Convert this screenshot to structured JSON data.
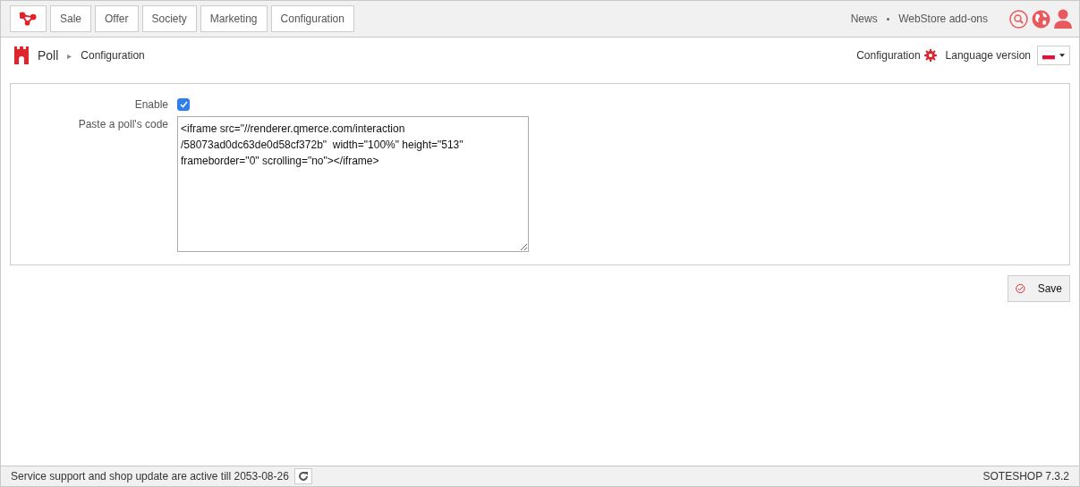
{
  "top_menu": [
    {
      "label": "Sale"
    },
    {
      "label": "Offer"
    },
    {
      "label": "Society"
    },
    {
      "label": "Marketing"
    },
    {
      "label": "Configuration"
    }
  ],
  "top_links": [
    "News",
    "•",
    "WebStore add-ons"
  ],
  "breadcrumb": {
    "module": "Poll",
    "separator": "▸",
    "page": "Configuration"
  },
  "header_actions": {
    "configuration": "Configuration",
    "language_label": "Language version"
  },
  "form": {
    "enable": {
      "label": "Enable",
      "checked": true
    },
    "code": {
      "label": "Paste a poll's code",
      "value": "<iframe src=\"//renderer.qmerce.com/interaction\n/58073ad0dc63de0d58cf372b\"  width=\"100%\" height=\"513\"\nframeborder=\"0\" scrolling=\"no\"></iframe>"
    }
  },
  "save_button": "Save",
  "status_bar": {
    "support": "Service support and shop update are active till 2053-08-26",
    "version": "SOTESHOP 7.3.2"
  }
}
